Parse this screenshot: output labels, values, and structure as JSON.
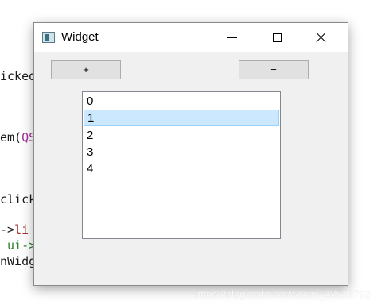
{
  "background_code": {
    "line1": "icked",
    "line2_prefix": "em(",
    "line2_kw": "QS",
    "line3": "click",
    "line4_prefix": "->",
    "line4_kw": "li",
    "line5_kw": "ui->",
    "line6": "nWidg"
  },
  "window": {
    "title": "Widget",
    "icon": "app-window-icon",
    "controls": [
      "minimize-icon",
      "maximize-icon",
      "close-icon"
    ]
  },
  "toolbar": {
    "add_label": "+",
    "remove_label": "−"
  },
  "list": {
    "items": [
      "0",
      "1",
      "2",
      "3",
      "4"
    ],
    "selected_index": 1,
    "selection_color": "#cce8ff"
  },
  "watermark": "https://blog.csdn.net/weixin_43519792"
}
